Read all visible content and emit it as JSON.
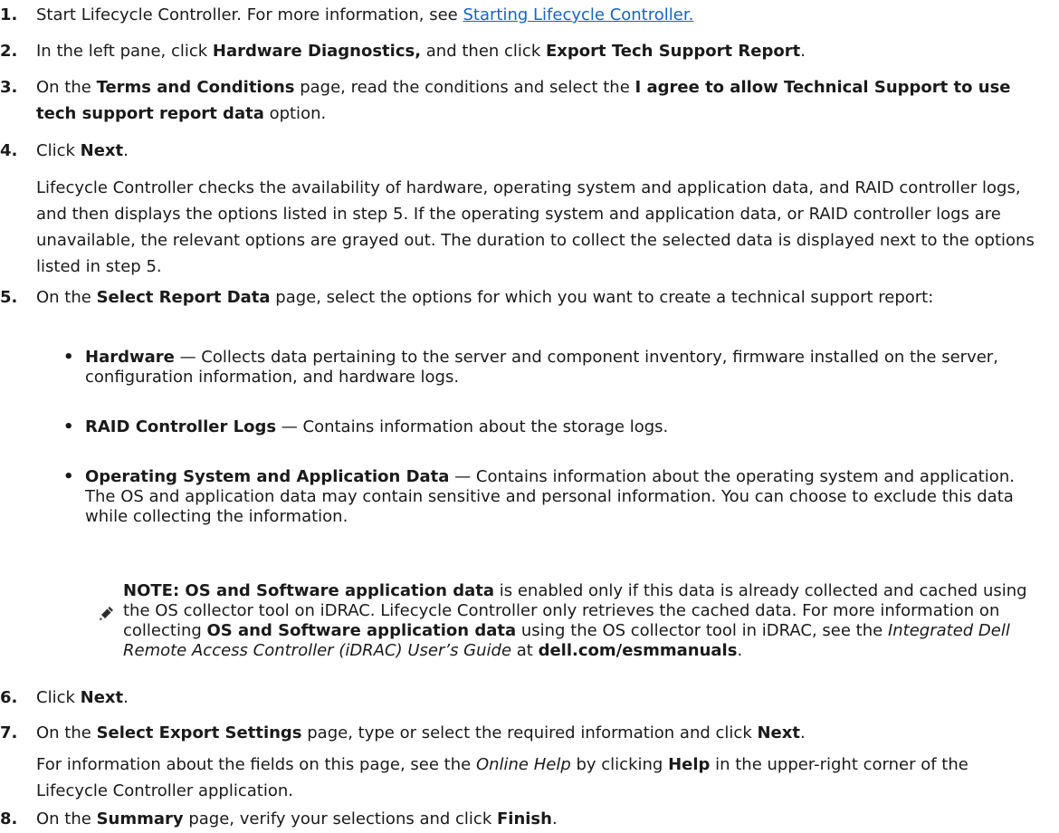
{
  "steps": [
    {
      "number": "1.",
      "text_a": "Start Lifecycle Controller. For more information, see ",
      "link": "Starting Lifecycle Controller."
    },
    {
      "number": "2.",
      "text_a": "In the left pane, click ",
      "bold_a": "Hardware Diagnostics,",
      "text_b": " and then click ",
      "bold_b": "Export Tech Support Report",
      "text_c": "."
    },
    {
      "number": "3.",
      "text_a": "On the ",
      "bold_a": "Terms and Conditions",
      "text_b": " page, read the conditions and select the ",
      "bold_b": "I agree to allow Technical Support to use tech support report data",
      "text_c": " option."
    },
    {
      "number": "4.",
      "text_a": "Click ",
      "bold_a": "Next",
      "text_b": ".",
      "para": "Lifecycle Controller checks the availability of hardware, operating system and application data, and RAID controller logs, and then displays the options listed in step 5. If the operating system and application data, or RAID controller logs are unavailable, the relevant options are grayed out. The duration to collect the selected data is displayed next to the options listed in step 5."
    },
    {
      "number": "5.",
      "text_a": "On the ",
      "bold_a": "Select Report Data",
      "text_b": " page, select the options for which you want to create a technical support report:"
    },
    {
      "number": "6.",
      "text_a": "Click ",
      "bold_a": "Next",
      "text_b": "."
    },
    {
      "number": "7.",
      "text_a": "On the ",
      "bold_a": "Select Export Settings",
      "text_b": " page, type or select the required information and click ",
      "bold_b": "Next",
      "text_c": ".",
      "para_a": "For information about the fields on this page, see the ",
      "para_italic": "Online Help",
      "para_b": " by clicking ",
      "para_bold": "Help",
      "para_c": " in the upper-right corner of the Lifecycle Controller application."
    },
    {
      "number": "8.",
      "text_a": "On the ",
      "bold_a": "Summary",
      "text_b": " page, verify your selections and click ",
      "bold_b": "Finish",
      "text_c": "."
    }
  ],
  "bullets": [
    {
      "symbol": "•",
      "title": "Hardware",
      "desc": " — Collects data pertaining to the server and component inventory, firmware installed on the server, configuration information, and hardware logs."
    },
    {
      "symbol": "•",
      "title": "RAID Controller Logs",
      "desc": " — Contains information about the storage logs."
    },
    {
      "symbol": "•",
      "title": "Operating System and Application Data",
      "desc": " — Contains information about the operating system and application. The OS and application data may contain sensitive and personal information. You can choose to exclude this data while collecting the information."
    }
  ],
  "note": {
    "icon": "pencil-note-icon",
    "label": "NOTE: ",
    "bold_a": "OS and Software application data",
    "text_a": " is enabled only if this data is already collected and cached using the OS collector tool on iDRAC. Lifecycle Controller only retrieves the cached data. For more information on collecting ",
    "bold_b": "OS and Software application data",
    "text_b": " using the OS collector tool in iDRAC, see the ",
    "italic": "Integrated Dell Remote Access Controller (iDRAC) User’s Guide",
    "text_c": " at ",
    "bold_c": "dell.com/esmmanuals",
    "text_d": "."
  },
  "colors": {
    "link": "#1565c0",
    "text": "#1a1a1a"
  }
}
